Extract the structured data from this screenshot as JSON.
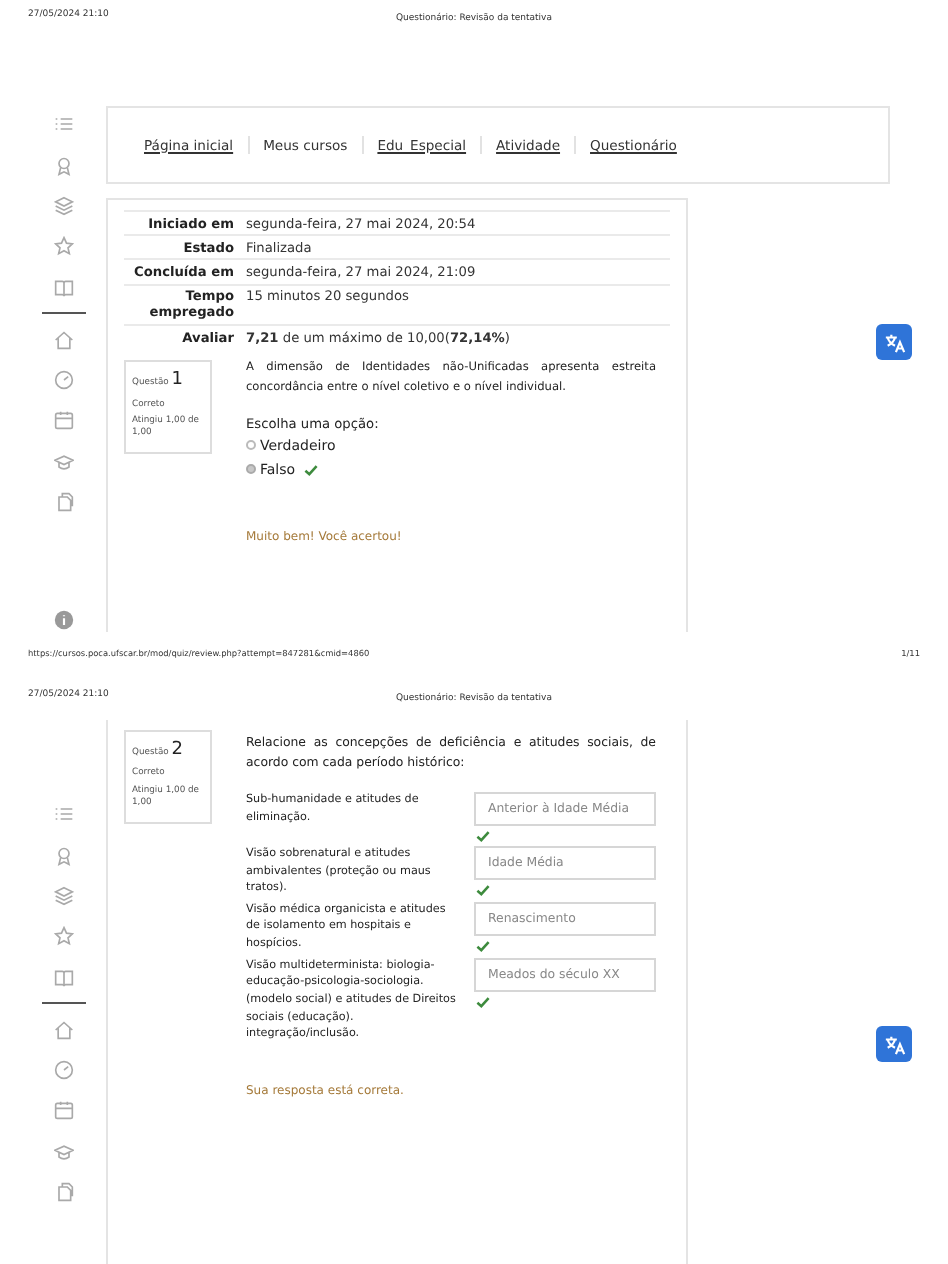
{
  "pages": [
    {
      "header_date": "27/05/2024 21:10",
      "header_title": "Questionário: Revisão da tentativa",
      "footer_url": "https://cursos.poca.ufscar.br/mod/quiz/review.php?attempt=847281&cmid=4860",
      "footer_page": "1/11"
    },
    {
      "header_date": "27/05/2024 21:10",
      "header_title": "Questionário: Revisão da tentativa"
    }
  ],
  "breadcrumb": [
    {
      "label": "Página inicial",
      "kind": "link"
    },
    {
      "label": "Meus cursos",
      "kind": "text"
    },
    {
      "label": "Edu_Especial",
      "kind": "link"
    },
    {
      "label": "Atividade",
      "kind": "link"
    },
    {
      "label": "Questionário",
      "kind": "link"
    }
  ],
  "summary": [
    {
      "label": "Iniciado em",
      "value": "segunda-feira, 27 mai 2024, 20:54"
    },
    {
      "label": "Estado",
      "value": "Finalizada"
    },
    {
      "label": "Concluída em",
      "value": "segunda-feira, 27 mai 2024, 21:09"
    },
    {
      "label": "Tempo empregado",
      "value": "15 minutos 20 segundos"
    },
    {
      "label": "Avaliar",
      "value": "**7,21** de um máximo de 10,00(**72,14%**)"
    }
  ],
  "questions": [
    {
      "kind": "multichoice",
      "label": "Questão",
      "number": "1",
      "status": "Correto",
      "grade": "Atingiu 1,00 de 1,00",
      "text": "A dimensão de Identidades não-Unificadas apresenta estreita concordância entre o nível coletivo e o nível individual.",
      "prompt": "Escolha uma opção:",
      "options": [
        {
          "label": "Verdadeiro",
          "selected": false,
          "correct": false
        },
        {
          "label": "Falso",
          "selected": true,
          "correct": true
        }
      ],
      "feedback": "Muito bem! Você acertou!"
    },
    {
      "kind": "match",
      "label": "Questão",
      "number": "2",
      "status": "Correto",
      "grade": "Atingiu 1,00 de 1,00",
      "text": "Relacione as concepções de deficiência e atitudes sociais, de acordo com cada período histórico:",
      "pairs": [
        {
          "stem": "Sub-humanidade e atitudes de eliminação.",
          "answer": "Anterior à Idade Média",
          "correct": true
        },
        {
          "stem": "Visão sobrenatural e atitudes ambivalentes (proteção ou maus tratos).",
          "answer": "Idade Média",
          "correct": true
        },
        {
          "stem": "Visão médica organicista e atitudes de isolamento em hospitais e hospícios.",
          "answer": "Renascimento",
          "correct": true
        },
        {
          "stem": "Visão multideterminista: biologia-educação-psicologia-sociologia. (modelo social) e atitudes de Direitos sociais (educação). integração/inclusão.",
          "answer": "Meados do século XX",
          "correct": true
        }
      ],
      "feedback": "Sua resposta está correta."
    }
  ]
}
